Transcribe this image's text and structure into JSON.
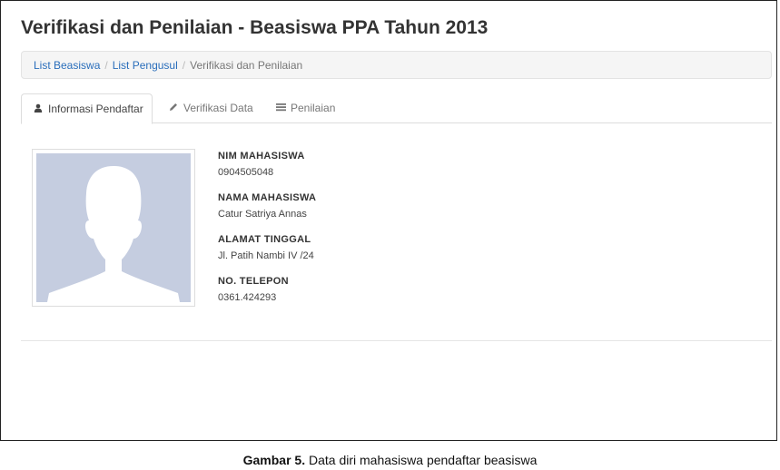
{
  "header": {
    "title": "Verifikasi dan Penilaian - Beasiswa PPA Tahun 2013"
  },
  "breadcrumb": {
    "items": [
      "List Beasiswa",
      "List Pengusul",
      "Verifikasi dan Penilaian"
    ],
    "separator": "/"
  },
  "tabs": [
    {
      "label": "Informasi Pendaftar",
      "icon": "user-icon",
      "active": true
    },
    {
      "label": "Verifikasi Data",
      "icon": "pencil-icon",
      "active": false
    },
    {
      "label": "Penilaian",
      "icon": "list-icon",
      "active": false
    }
  ],
  "profile": {
    "photo_icon": "avatar-placeholder",
    "fields": [
      {
        "label": "NIM MAHASISWA",
        "value": "0904505048"
      },
      {
        "label": "NAMA MAHASISWA",
        "value": "Catur Satriya Annas"
      },
      {
        "label": "ALAMAT TINGGAL",
        "value": "Jl. Patih Nambi IV /24"
      },
      {
        "label": "NO. TELEPON",
        "value": "0361.424293"
      }
    ]
  },
  "caption": {
    "prefix": "Gambar 5.",
    "text": "Data diri mahasiswa pendaftar beasiswa"
  },
  "colors": {
    "link": "#2a6ebb",
    "avatar_bg": "#c5cde0"
  }
}
